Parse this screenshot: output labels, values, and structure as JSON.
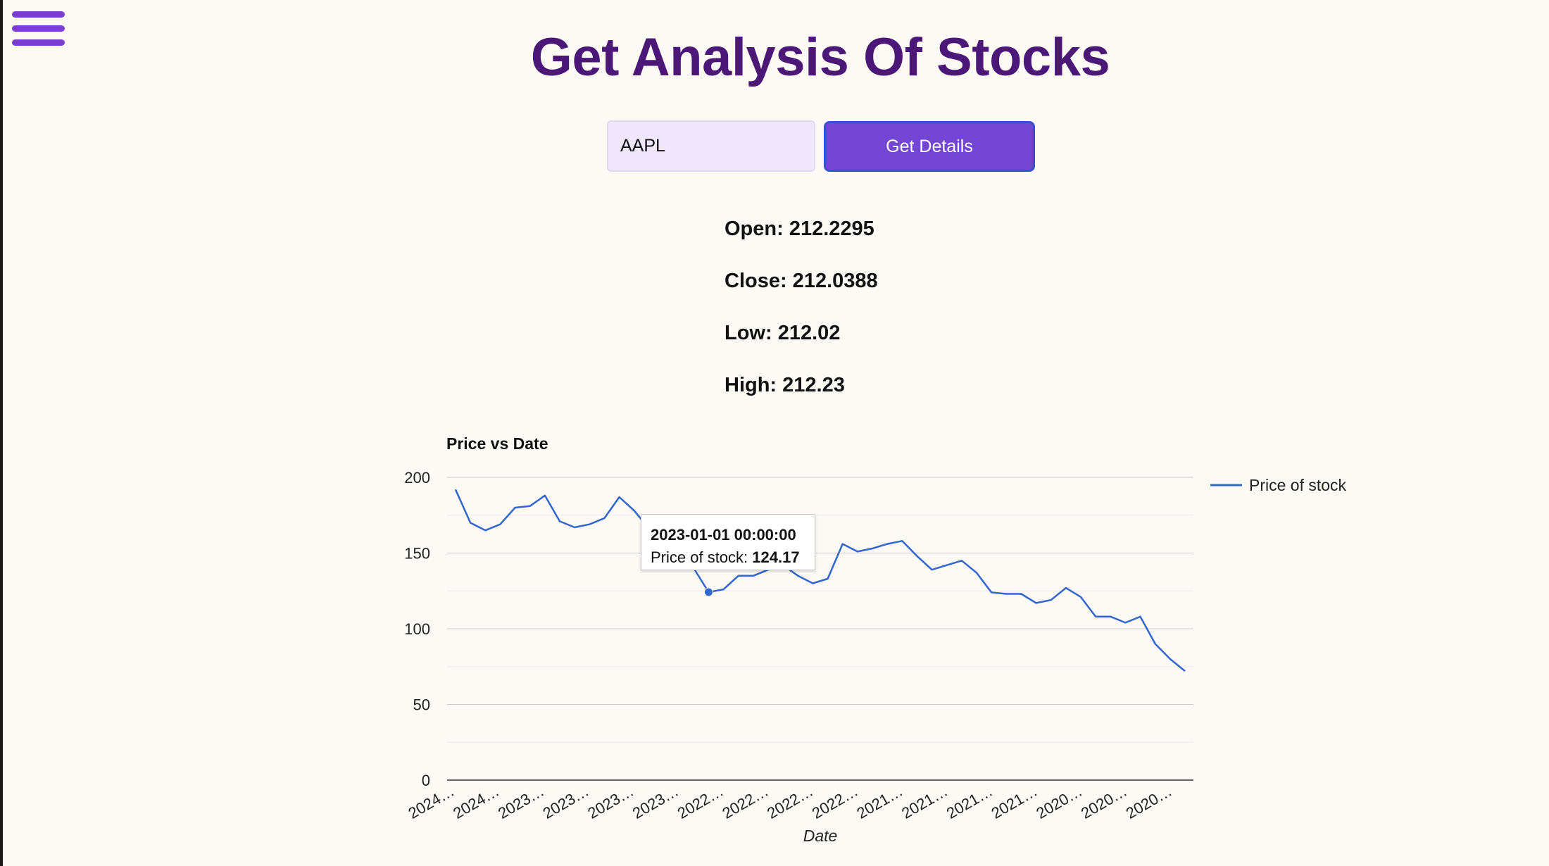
{
  "header": {
    "title": "Get Analysis Of Stocks",
    "menu_icon": "hamburger-menu-icon"
  },
  "search": {
    "value": "AAPL",
    "button_label": "Get Details"
  },
  "stats": [
    {
      "label": "Open: 212.2295"
    },
    {
      "label": "Close: 212.0388"
    },
    {
      "label": "Low: 212.02"
    },
    {
      "label": "High: 212.23"
    }
  ],
  "colors": {
    "title": "#4b1878",
    "accent": "#7345d3",
    "line": "#3366cc",
    "input_bg": "#efe6fb"
  },
  "tooltip": {
    "date": "2023-01-01 00:00:00",
    "label": "Price of stock:",
    "value": "124.17"
  },
  "chart_data": {
    "type": "line",
    "title": "Price vs Date",
    "xlabel": "Date",
    "ylabel": "",
    "ylim": [
      0,
      200
    ],
    "y_ticks": [
      0,
      50,
      100,
      150,
      200
    ],
    "x_tick_labels": [
      "2024…",
      "2024…",
      "2023…",
      "2023…",
      "2023…",
      "2023…",
      "2022…",
      "2022…",
      "2022…",
      "2022…",
      "2021…",
      "2021…",
      "2021…",
      "2021…",
      "2020…",
      "2020…",
      "2020…"
    ],
    "legend_position": "right",
    "grid": true,
    "highlighted_index": 17,
    "series": [
      {
        "name": "Price of stock",
        "values": [
          192,
          170,
          165,
          169,
          180,
          181,
          188,
          171,
          167,
          169,
          173,
          187,
          178,
          166,
          155,
          150,
          140,
          124.17,
          126,
          135,
          135,
          139,
          142,
          135,
          130,
          133,
          156,
          151,
          153,
          156,
          158,
          148,
          139,
          142,
          145,
          137,
          124,
          123,
          123,
          117,
          119,
          127,
          121,
          108,
          108,
          104,
          108,
          90,
          80,
          72
        ]
      }
    ]
  }
}
